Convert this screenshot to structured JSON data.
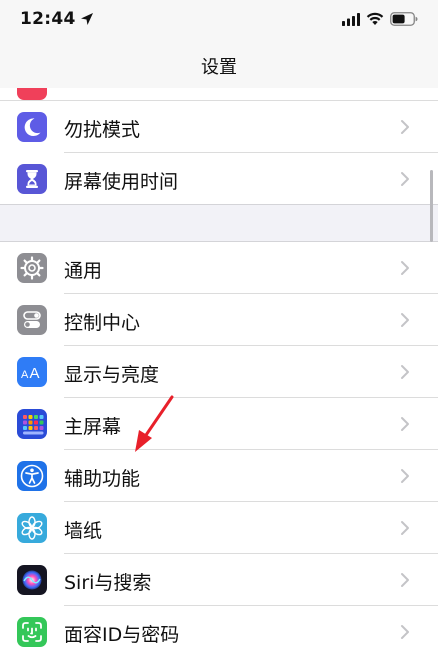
{
  "status_bar": {
    "time": "12:44"
  },
  "nav": {
    "title": "设置"
  },
  "group1": [
    {
      "label": "勿扰模式"
    },
    {
      "label": "屏幕使用时间"
    }
  ],
  "group2": [
    {
      "label": "通用"
    },
    {
      "label": "控制中心"
    },
    {
      "label": "显示与亮度"
    },
    {
      "label": "主屏幕"
    },
    {
      "label": "辅助功能"
    },
    {
      "label": "墙纸"
    },
    {
      "label": "Siri与搜索"
    },
    {
      "label": "面容ID与密码"
    }
  ],
  "colors": {
    "accent_red_arrow": "#e8202a",
    "dnd_icon": "#5e5ce6",
    "screen_time_icon": "#5856d6",
    "general_icon": "#8e8e93",
    "display_icon": "#2f7cf6",
    "home_icon": "#2a4bd7",
    "accessibility_icon": "#1f72e8",
    "wallpaper_icon": "#37aadc",
    "face_id_icon": "#34c759"
  },
  "icons": [
    "location-arrow-icon",
    "cellular-signal-icon",
    "wifi-icon",
    "battery-icon",
    "moon-icon",
    "hourglass-icon",
    "gear-icon",
    "toggles-icon",
    "text-size-icon",
    "app-grid-icon",
    "accessibility-person-icon",
    "flower-icon",
    "siri-orb-icon",
    "face-id-icon",
    "chevron-right-icon",
    "red-arrow-annotation"
  ]
}
